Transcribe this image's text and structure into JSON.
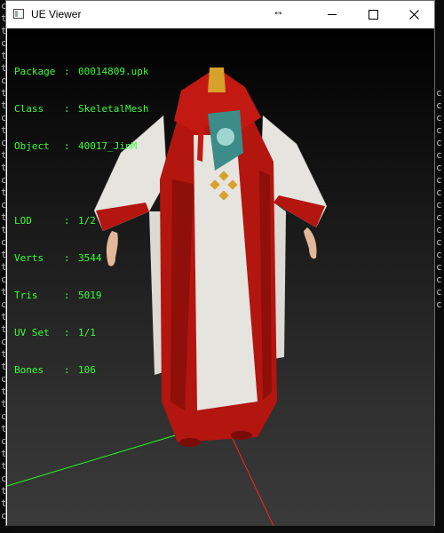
{
  "window": {
    "title": "UE Viewer",
    "icons": {
      "app": "app-window-icon",
      "resize": "resize-horizontal-icon",
      "minimize": "minimize-icon",
      "maximize": "maximize-icon",
      "close": "close-icon"
    }
  },
  "info": {
    "package": {
      "label": "Package",
      "sep": ":",
      "value": "00014809.upk"
    },
    "class": {
      "label": "Class",
      "sep": ":",
      "value": "SkeletalMesh"
    },
    "object": {
      "label": "Object",
      "sep": ":",
      "value": "40017_JinM"
    },
    "lod": {
      "label": "LOD",
      "sep": ":",
      "value": "1/2"
    },
    "verts": {
      "label": "Verts",
      "sep": ":",
      "value": "3544"
    },
    "tris": {
      "label": "Tris",
      "sep": ":",
      "value": "5019"
    },
    "uvset": {
      "label": "UV Set",
      "sep": ":",
      "value": "1/1"
    },
    "bones": {
      "label": "Bones",
      "sep": ":",
      "value": "106"
    }
  },
  "colors": {
    "info_text": "#3aff3a",
    "axis_x": "#ff2020",
    "axis_y": "#20ff20",
    "robe_red": "#b3150f",
    "robe_white": "#e6e4df",
    "gold": "#d8a12a"
  }
}
